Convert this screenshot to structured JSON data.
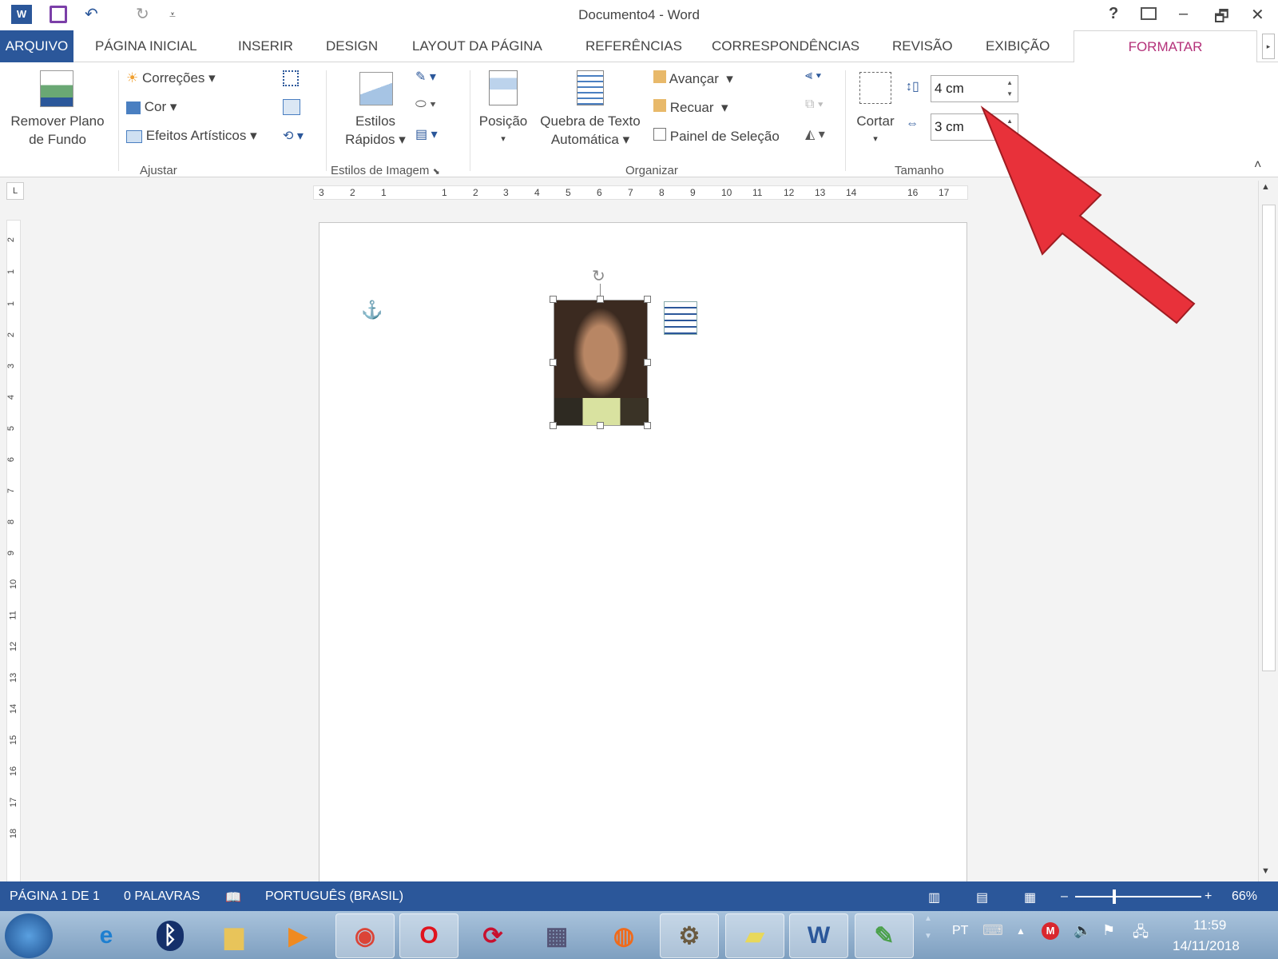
{
  "window": {
    "title": "Documento4 - Word",
    "help": "?",
    "minimize": "–",
    "restore": "🗗",
    "close": "✕"
  },
  "quick_access": {
    "undo": "↶",
    "redo": "↻",
    "customize": "⩡"
  },
  "tabs": [
    {
      "label": "ARQUIVO"
    },
    {
      "label": "PÁGINA INICIAL"
    },
    {
      "label": "INSERIR"
    },
    {
      "label": "DESIGN"
    },
    {
      "label": "LAYOUT DA PÁGINA"
    },
    {
      "label": "REFERÊNCIAS"
    },
    {
      "label": "CORRESPONDÊNCIAS"
    },
    {
      "label": "REVISÃO"
    },
    {
      "label": "EXIBIÇÃO"
    },
    {
      "label": "FORMATAR",
      "active": true
    }
  ],
  "ribbon": {
    "ajustar": {
      "label": "Ajustar",
      "remove_bg": "Remover Plano",
      "remove_bg2": "de Fundo",
      "correcoes": "Correções",
      "cor": "Cor",
      "efeitos": "Efeitos Artísticos"
    },
    "estilos": {
      "label": "Estilos de Imagem",
      "estilos_rapidos": "Estilos",
      "estilos_rapidos2": "Rápidos"
    },
    "organizar": {
      "label": "Organizar",
      "posicao": "Posição",
      "quebra": "Quebra de Texto",
      "quebra2": "Automática",
      "avancar": "Avançar",
      "recuar": "Recuar",
      "painel": "Painel de Seleção"
    },
    "tamanho": {
      "label": "Tamanho",
      "cortar": "Cortar",
      "height": "4 cm",
      "width": "3 cm"
    }
  },
  "ruler": {
    "h_ticks": [
      "3",
      "2",
      "1",
      "1",
      "2",
      "3",
      "4",
      "5",
      "6",
      "7",
      "8",
      "9",
      "10",
      "11",
      "12",
      "13",
      "14",
      "16",
      "17"
    ],
    "v_ticks": [
      "2",
      "1",
      "1",
      "2",
      "3",
      "4",
      "5",
      "6",
      "7",
      "8",
      "9",
      "10",
      "11",
      "12",
      "13",
      "14",
      "15",
      "16",
      "17",
      "18"
    ]
  },
  "status": {
    "page": "PÁGINA 1 DE 1",
    "words": "0 PALAVRAS",
    "language": "PORTUGUÊS (BRASIL)",
    "zoom": "66%",
    "zoom_level": 66
  },
  "taskbar": {
    "lang": "PT",
    "time": "11:59",
    "date": "14/11/2018"
  },
  "colors": {
    "accent": "#2b579a",
    "format_tab": "#b4317a",
    "arrow": "#e8313a"
  }
}
